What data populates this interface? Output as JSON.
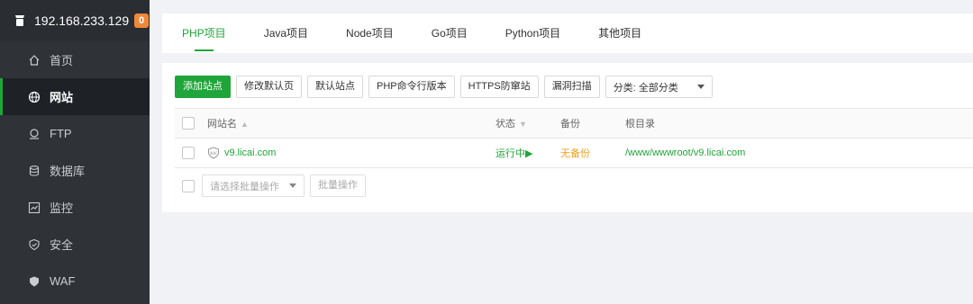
{
  "server": {
    "ip": "192.168.233.129",
    "badge": "0"
  },
  "sidebar": {
    "items": [
      {
        "label": "首页",
        "icon": "home-icon"
      },
      {
        "label": "网站",
        "icon": "globe-icon",
        "active": true
      },
      {
        "label": "FTP",
        "icon": "ftp-icon"
      },
      {
        "label": "数据库",
        "icon": "database-icon"
      },
      {
        "label": "监控",
        "icon": "monitor-icon"
      },
      {
        "label": "安全",
        "icon": "shield-icon"
      },
      {
        "label": "WAF",
        "icon": "waf-icon"
      }
    ]
  },
  "tabs": [
    {
      "label": "PHP项目",
      "active": true
    },
    {
      "label": "Java项目"
    },
    {
      "label": "Node项目"
    },
    {
      "label": "Go项目"
    },
    {
      "label": "Python项目"
    },
    {
      "label": "其他项目"
    }
  ],
  "toolbar": {
    "add_site": "添加站点",
    "edit_default_page": "修改默认页",
    "default_site": "默认站点",
    "php_cli_version": "PHP命令行版本",
    "https_anti_steal": "HTTPS防窜站",
    "vuln_scan": "漏洞扫描",
    "category_select": "分类: 全部分类"
  },
  "table": {
    "headers": {
      "name": "网站名",
      "status": "状态",
      "backup": "备份",
      "root": "根目录"
    },
    "rows": [
      {
        "name": "v9.licai.com",
        "status": "运行中▶",
        "backup": "无备份",
        "root": "/www/wwwroot/v9.licai.com"
      }
    ]
  },
  "batch": {
    "placeholder": "请选择批量操作",
    "button": "批量操作"
  },
  "colors": {
    "accent": "#20a53a",
    "sidebar_bg": "#2f3338",
    "badge": "#f0883a",
    "warning": "#f0a020"
  }
}
